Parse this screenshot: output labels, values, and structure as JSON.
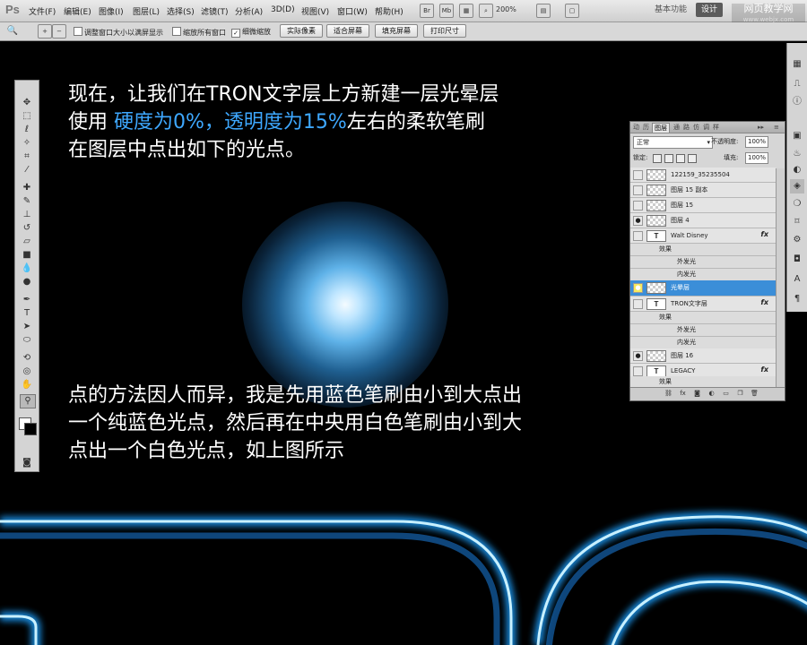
{
  "app": {
    "logo": "Ps"
  },
  "menubar": {
    "items": [
      "文件(F)",
      "编辑(E)",
      "图像(I)",
      "图层(L)",
      "选择(S)",
      "滤镜(T)",
      "分析(A)",
      "3D(D)",
      "视图(V)",
      "窗口(W)",
      "帮助(H)"
    ],
    "icons": [
      "Br",
      "Mb"
    ],
    "zoom": "200%",
    "workspace_basic": "基本功能",
    "workspace_design": "设计",
    "watermark_main": "网页教学网",
    "watermark_sub": "www.webjx.com"
  },
  "options_bar": {
    "checkbox_resize": "调整窗口大小以满屏显示",
    "checkbox_zoom_all": "缩放所有窗口",
    "checkbox_scrubby": "细微缩放",
    "btn_actual": "实际像素",
    "btn_fit": "适合屏幕",
    "btn_fill": "填充屏幕",
    "btn_print": "打印尺寸"
  },
  "canvas": {
    "line1": "现在，让我们在TRON文字层上方新建一层光晕层",
    "line2_prefix": "使用 ",
    "line2_highlight": "硬度为0%，透明度为15%",
    "line2_suffix": "左右的柔软笔刷",
    "line3": "在图层中点出如下的光点。",
    "para2_line1": "点的方法因人而异，我是先用蓝色笔刷由小到大点出",
    "para2_line2": "一个纯蓝色光点，然后再在中央用白色笔刷由小到大",
    "para2_line3": "点出一个白色光点，如上图所示",
    "highlight_color": "#3ea8ff"
  },
  "layers_panel": {
    "tabs": [
      "动",
      "历",
      "图层",
      "通",
      "路",
      "仿",
      "调",
      "样"
    ],
    "blend_mode": "正常",
    "opacity_label": "不透明度:",
    "opacity_value": "100%",
    "lock_label": "锁定:",
    "fill_label": "填充:",
    "fill_value": "100%",
    "layers": [
      {
        "name": "122159_35235504"
      },
      {
        "name": "图层 15 副本"
      },
      {
        "name": "图层 15"
      },
      {
        "name": "图层 4"
      },
      {
        "name": "Walt Disney",
        "fx": "fx"
      },
      {
        "name": "效果"
      },
      {
        "name": "外发光"
      },
      {
        "name": "内发光"
      },
      {
        "name": "光晕层"
      },
      {
        "name": "TRON文字层",
        "fx": "fx"
      },
      {
        "name": "效果"
      },
      {
        "name": "外发光"
      },
      {
        "name": "内发光"
      },
      {
        "name": "图层 16"
      },
      {
        "name": "LEGACY",
        "fx": "fx"
      },
      {
        "name": "效果"
      }
    ]
  }
}
